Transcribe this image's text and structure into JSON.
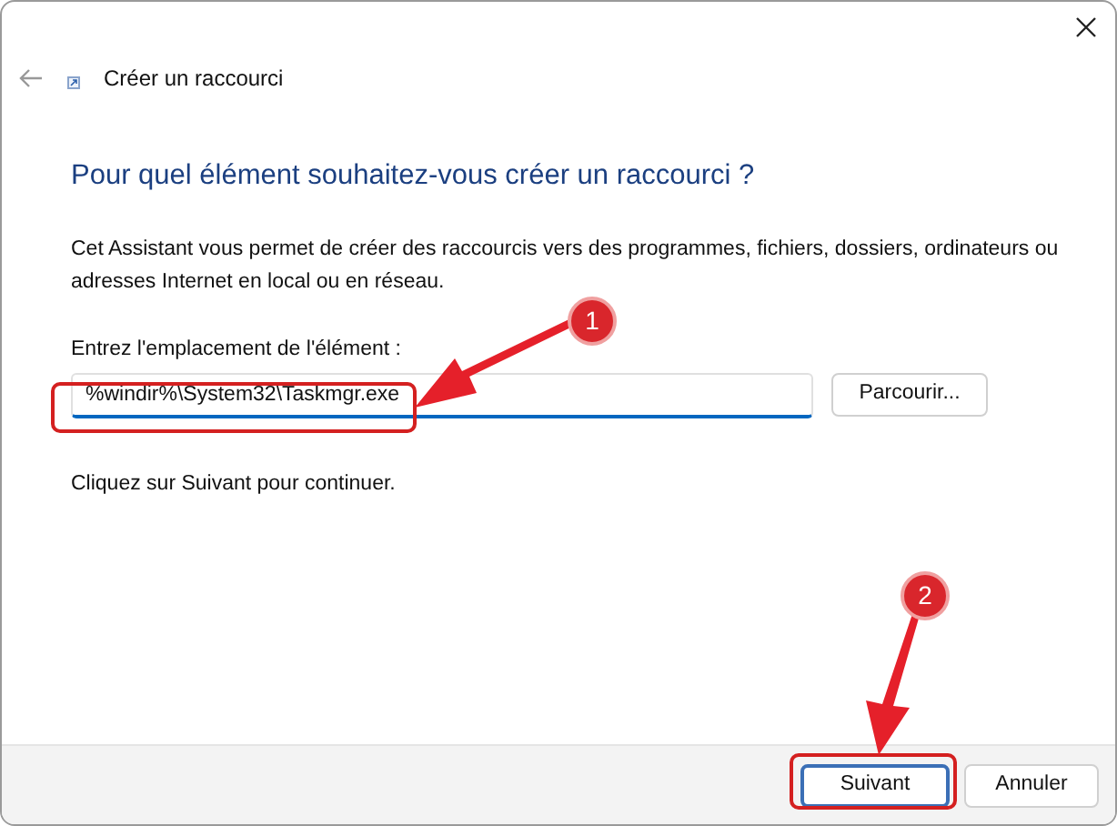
{
  "window": {
    "title": "Créer un raccourci"
  },
  "heading": "Pour quel élément souhaitez-vous créer un raccourci ?",
  "description": "Cet Assistant vous permet de créer des raccourcis vers des programmes, fichiers, dossiers, ordinateurs ou adresses Internet en local ou en réseau.",
  "location_field": {
    "label": "Entrez l'emplacement de l'élément :",
    "value": "%windir%\\System32\\Taskmgr.exe"
  },
  "browse_button": "Parcourir...",
  "hint": "Cliquez sur Suivant pour continuer.",
  "buttons": [
    {
      "label": "Suivant",
      "kind": "primary"
    },
    {
      "label": "Annuler",
      "kind": "secondary"
    }
  ],
  "annotations": [
    {
      "number": "1"
    },
    {
      "number": "2"
    }
  ]
}
